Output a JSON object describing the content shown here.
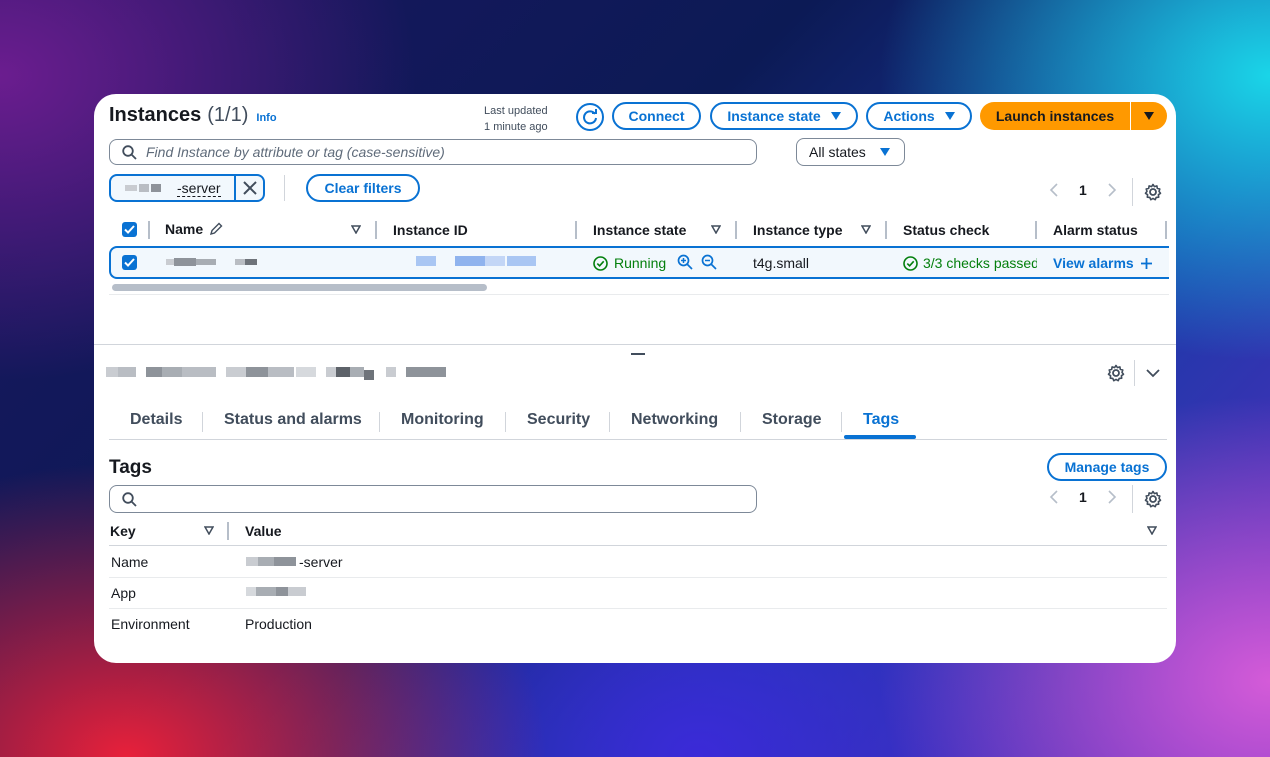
{
  "header": {
    "title": "Instances",
    "count": "(1/1)",
    "info": "Info",
    "last_updated_line1": "Last updated",
    "last_updated_line2": "1 minute ago",
    "connect": "Connect",
    "instance_state": "Instance state",
    "actions": "Actions",
    "launch": "Launch instances"
  },
  "search": {
    "placeholder": "Find Instance by attribute or tag (case-sensitive)",
    "states_filter": "All states"
  },
  "filter": {
    "token": "-server",
    "clear": "Clear filters"
  },
  "pagination": {
    "page": "1"
  },
  "table": {
    "columns": [
      "Name",
      "Instance ID",
      "Instance state",
      "Instance type",
      "Status check",
      "Alarm status"
    ],
    "row": {
      "state": "Running",
      "type": "t4g.small",
      "status": "3/3 checks passed",
      "alarm": "View alarms"
    }
  },
  "tabs": [
    "Details",
    "Status and alarms",
    "Monitoring",
    "Security",
    "Networking",
    "Storage",
    "Tags"
  ],
  "active_tab": "Tags",
  "tags": {
    "title": "Tags",
    "manage": "Manage tags",
    "page": "1",
    "columns": [
      "Key",
      "Value"
    ],
    "rows": [
      {
        "key": "Name",
        "value": "-server"
      },
      {
        "key": "App",
        "value": ""
      },
      {
        "key": "Environment",
        "value": "Production"
      }
    ]
  },
  "colors": {
    "accent": "#0972d3",
    "launch": "#ff9900",
    "success": "#037f0c"
  }
}
